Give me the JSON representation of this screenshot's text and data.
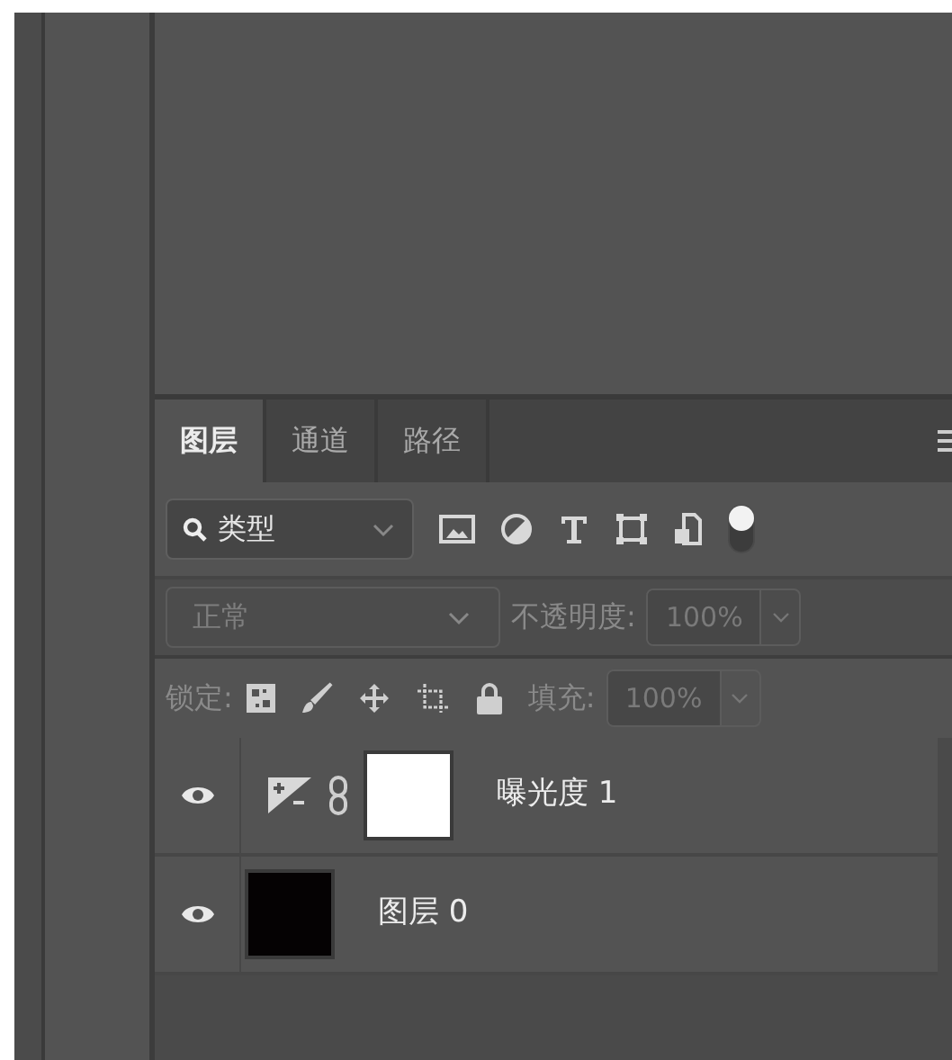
{
  "tabs": [
    {
      "label": "图层",
      "selected": true
    },
    {
      "label": "通道",
      "selected": false
    },
    {
      "label": "路径",
      "selected": false
    }
  ],
  "filter": {
    "value": "类型",
    "enabled": true
  },
  "blend_mode": {
    "value": "正常",
    "disabled": true
  },
  "opacity": {
    "label": "不透明度:",
    "value": "100%",
    "disabled": true
  },
  "lock": {
    "label": "锁定:"
  },
  "fill": {
    "label": "填充:",
    "value": "100%",
    "disabled": true
  },
  "layers": [
    {
      "kind": "adjustment",
      "name": "曝光度 1",
      "visible": true
    },
    {
      "kind": "pixel",
      "name": "图层 0",
      "visible": true
    }
  ]
}
